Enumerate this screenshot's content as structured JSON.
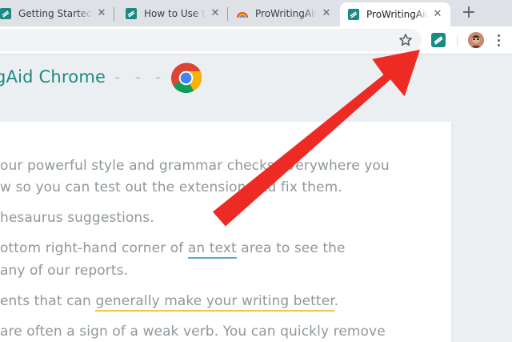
{
  "tabs": [
    {
      "title": "Getting Started",
      "close": "✕"
    },
    {
      "title": "How to Use the",
      "close": "✕"
    },
    {
      "title": "ProWritingAid",
      "close": "✕"
    },
    {
      "title": "ProWritingAid",
      "close": "✕"
    }
  ],
  "new_tab": "+",
  "heading": {
    "text": "gAid Chrome",
    "dashes": "- - -"
  },
  "content": {
    "line1": "our powerful style and grammar checks everywhere you",
    "line2": "w so you can test out the extension and fix them.",
    "line3": "hesaurus suggestions.",
    "line4_pre": "ottom right-hand corner of ",
    "line4_link": "an text",
    "line4_post": " area to see the",
    "line5": " any of our reports.",
    "line6_pre": "ents that can ",
    "line6_link": "generally make your writing better",
    "line6_post": ".",
    "line7": "are often a sign of a weak verb. You can quickly remove"
  },
  "colors": {
    "brand": "#1c8a80",
    "arrow": "#ee2a24",
    "body_text": "#8f979c"
  },
  "icons": {
    "extension": "prowritingaid-icon",
    "bookmark": "star-icon",
    "menu": "kebab-icon"
  }
}
